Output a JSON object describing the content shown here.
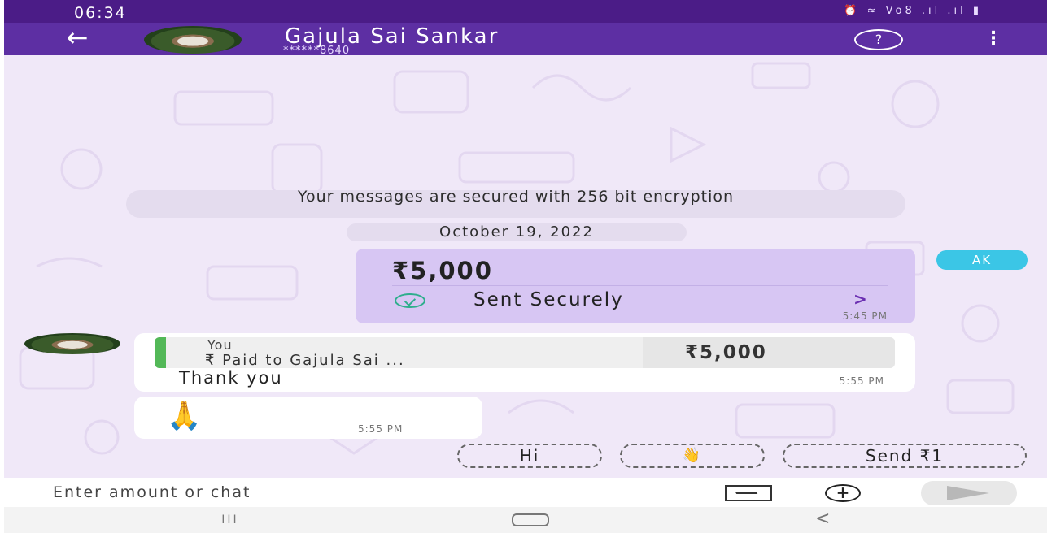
{
  "status_bar": {
    "time": "06:34",
    "icons_text": "⏰ ≈ Vo8 .ıl .ıl ▮"
  },
  "header": {
    "back_glyph": "←",
    "contact_name": "Gajula Sai Sankar",
    "contact_phone_masked": "******8640",
    "help_glyph": "?",
    "menu_glyph": "⋮"
  },
  "chat": {
    "encryption_notice": "Your messages are secured with 256 bit encryption",
    "date_label": "October 19, 2022",
    "sent_payment": {
      "amount": "₹5,000",
      "status": "Sent Securely",
      "chevron": ">",
      "time": "5:45 PM",
      "sender_badge": "AK"
    },
    "reply_message": {
      "quote_author": "You",
      "quote_text": "₹ Paid to Gajula Sai ...",
      "quote_amount": "₹5,000",
      "text": "Thank you",
      "time": "5:55 PM"
    },
    "emoji_message": {
      "emoji": "🙏",
      "time": "5:55 PM"
    },
    "quick_replies": [
      {
        "label": "Hi"
      },
      {
        "label": "👋"
      },
      {
        "label": "Send ₹1"
      }
    ]
  },
  "input_bar": {
    "placeholder": "Enter amount or chat",
    "plus_glyph": "+"
  },
  "nav_bar": {
    "recent_glyph": "III",
    "back_glyph": "<"
  },
  "colors": {
    "status_bar": "#4b1c87",
    "header": "#5d2fa3",
    "chat_bg": "#f0e8f8",
    "payment_card": "#d7c6f3",
    "badge": "#3bc6e6",
    "check": "#2eae8c",
    "quote_bar": "#53b857"
  }
}
